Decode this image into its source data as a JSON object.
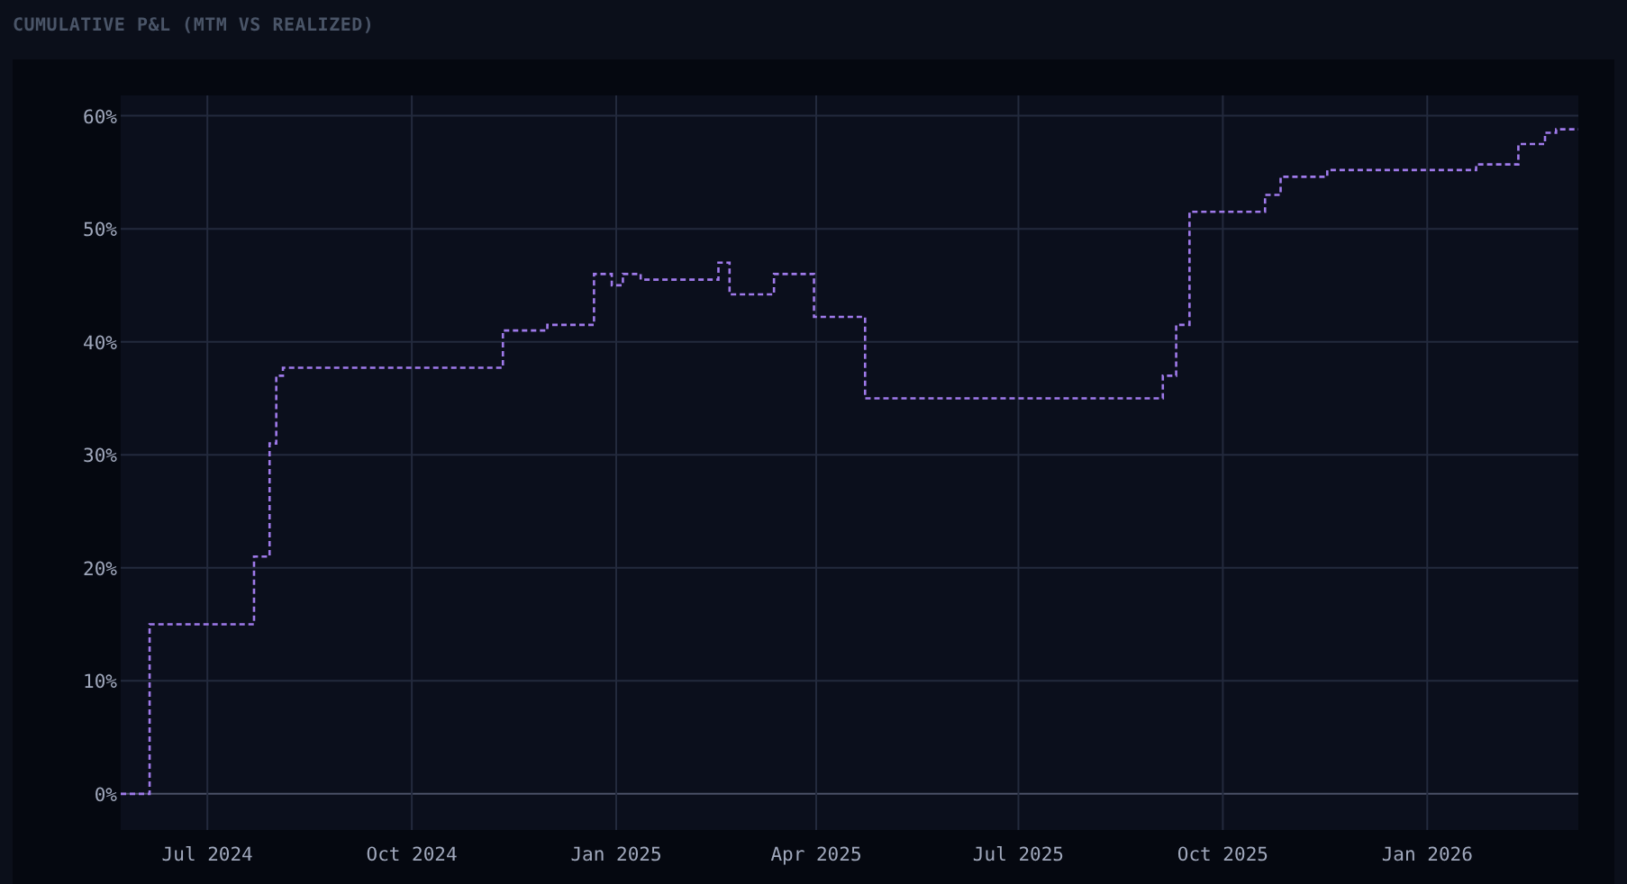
{
  "title": "CUMULATIVE P&L (MTM VS REALIZED)",
  "chart_data": {
    "type": "line",
    "grid": true,
    "xlim": [
      "2024-05-23",
      "2026-03-10"
    ],
    "ylim": [
      -3.2,
      61.8
    ],
    "xticks": [
      {
        "value": "2024-07-01",
        "label": "Jul 2024"
      },
      {
        "value": "2024-10-01",
        "label": "Oct 2024"
      },
      {
        "value": "2025-01-01",
        "label": "Jan 2025"
      },
      {
        "value": "2025-04-01",
        "label": "Apr 2025"
      },
      {
        "value": "2025-07-01",
        "label": "Jul 2025"
      },
      {
        "value": "2025-10-01",
        "label": "Oct 2025"
      },
      {
        "value": "2026-01-01",
        "label": "Jan 2026"
      }
    ],
    "yticks": [
      {
        "value": 0,
        "label": "0%"
      },
      {
        "value": 10,
        "label": "10%"
      },
      {
        "value": 20,
        "label": "20%"
      },
      {
        "value": 30,
        "label": "30%"
      },
      {
        "value": 40,
        "label": "40%"
      },
      {
        "value": 50,
        "label": "50%"
      },
      {
        "value": 60,
        "label": "60%"
      }
    ],
    "x": [
      "2024-05-23",
      "2024-06-05",
      "2024-06-05",
      "2024-07-22",
      "2024-07-22",
      "2024-07-29",
      "2024-07-29",
      "2024-08-01",
      "2024-08-01",
      "2024-08-04",
      "2024-08-04",
      "2024-11-11",
      "2024-11-11",
      "2024-12-01",
      "2024-12-01",
      "2024-12-22",
      "2024-12-22",
      "2024-12-30",
      "2024-12-30",
      "2025-01-04",
      "2025-01-04",
      "2025-01-12",
      "2025-01-12",
      "2025-02-16",
      "2025-02-16",
      "2025-02-21",
      "2025-02-21",
      "2025-03-13",
      "2025-03-13",
      "2025-03-31",
      "2025-03-31",
      "2025-04-23",
      "2025-04-23",
      "2025-09-04",
      "2025-09-04",
      "2025-09-10",
      "2025-09-10",
      "2025-09-16",
      "2025-09-16",
      "2025-10-20",
      "2025-10-20",
      "2025-10-27",
      "2025-10-27",
      "2025-11-17",
      "2025-11-17",
      "2026-01-23",
      "2026-01-23",
      "2026-02-11",
      "2026-02-11",
      "2026-02-23",
      "2026-02-23",
      "2026-02-28",
      "2026-02-28",
      "2026-03-10"
    ],
    "series": [
      {
        "color": "#9f7aea",
        "line_style": "dashed",
        "values": [
          0,
          0,
          15,
          15,
          21,
          21,
          31,
          31,
          37,
          37,
          37.7,
          37.7,
          41,
          41,
          41.5,
          41.5,
          46,
          46,
          45,
          45,
          46,
          46,
          45.5,
          45.5,
          47,
          47,
          44.2,
          44.2,
          46,
          46,
          42.2,
          42.2,
          35,
          35,
          37,
          37,
          41.5,
          41.5,
          51.5,
          51.5,
          53,
          53,
          54.6,
          54.6,
          55.2,
          55.2,
          55.7,
          55.7,
          57.5,
          57.5,
          58.5,
          58.5,
          58.8,
          58.8
        ]
      }
    ]
  }
}
